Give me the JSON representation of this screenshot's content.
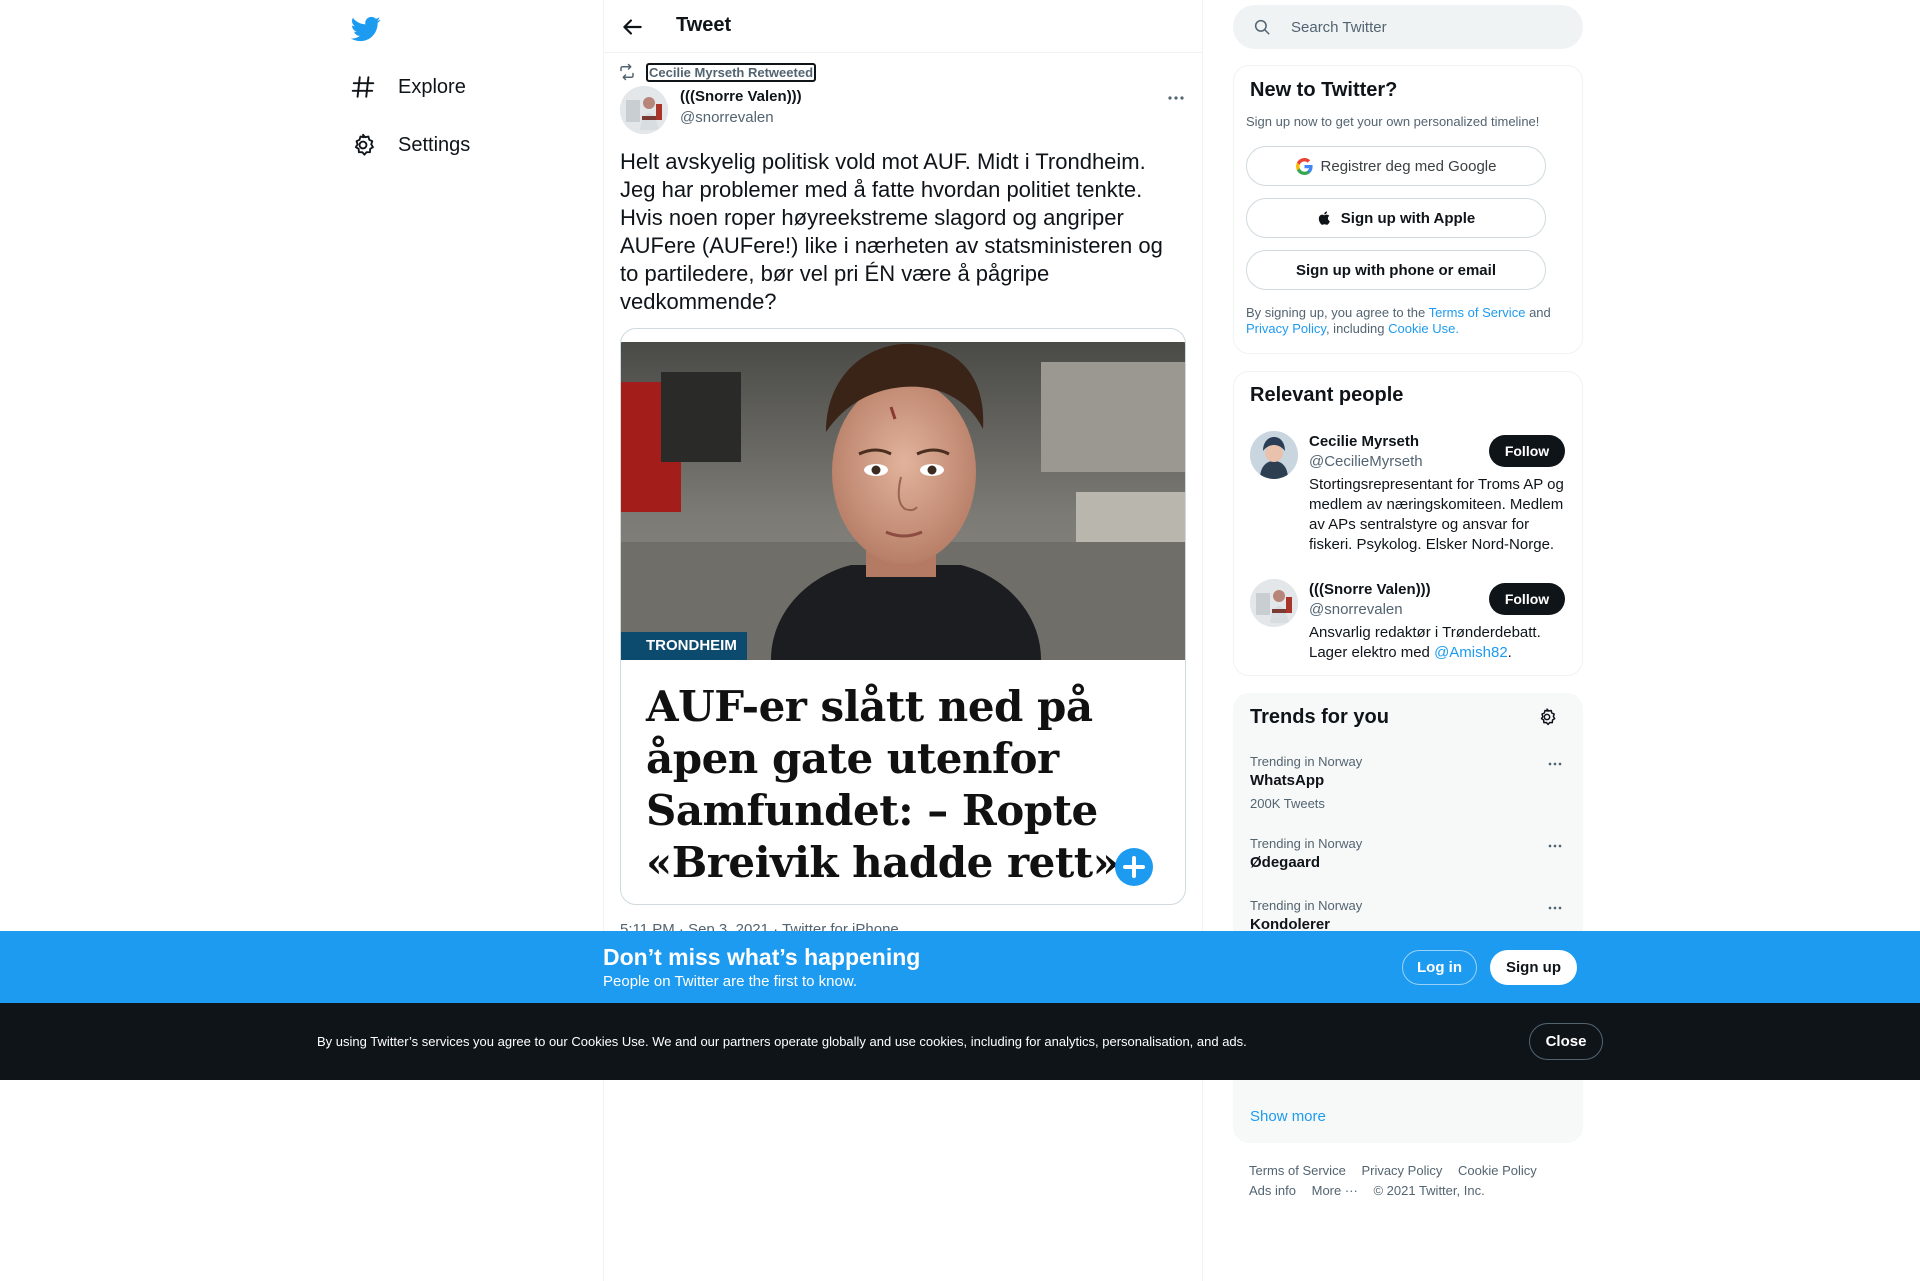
{
  "nav": {
    "logo": "twitter-bird-icon",
    "items": [
      {
        "label": "Explore",
        "icon": "hashtag-icon"
      },
      {
        "label": "Settings",
        "icon": "gear-icon"
      }
    ]
  },
  "header": {
    "title": "Tweet"
  },
  "tweet": {
    "retweeted_by": "Cecilie Myrseth Retweeted",
    "author_name": "(((Snorre Valen)))",
    "author_handle": "@snorrevalen",
    "text": "Helt avskyelig politisk vold mot AUF. Midt i Trondheim. Jeg har problemer med å fatte hvordan politiet tenkte. Hvis noen roper høyreekstreme slagord og angriper AUFere (AUFere!) like i nærheten av statsministeren og to partiledere, bør vel pri ÉN være å pågripe vedkommende?",
    "card": {
      "tag": "TRONDHEIM",
      "headline": "AUF-er slått ned på åpen gate utenfor Samfundet: – Ropte «Breivik hadde rett»"
    },
    "meta": "5:11 PM · Sep 3, 2021 · Twitter for iPhone"
  },
  "search": {
    "placeholder": "Search Twitter"
  },
  "signup": {
    "title": "New to Twitter?",
    "subtitle": "Sign up now to get your own personalized timeline!",
    "google": "Registrer deg med Google",
    "apple": "Sign up with Apple",
    "phone": "Sign up with phone or email",
    "legal_prefix": "By signing up, you agree to the",
    "terms": "Terms of Service",
    "and": "and",
    "privacy": "Privacy Policy",
    "including": ", including",
    "cookie": "Cookie Use."
  },
  "people": {
    "title": "Relevant people",
    "list": [
      {
        "name": "Cecilie Myrseth",
        "handle": "@CecilieMyrseth",
        "bio": "Stortingsrepresentant for Troms AP og medlem av næringskomiteen. Medlem av APs sentralstyre og ansvar for fiskeri. Psykolog. Elsker Nord-Norge.",
        "follow": "Follow"
      },
      {
        "name": "(((Snorre Valen)))",
        "handle": "@snorrevalen",
        "bio_prefix": "Ansvarlig redaktør i Trønderdebatt. Lager elektro med",
        "bio_link": "@Amish82",
        "bio_suffix": ".",
        "follow": "Follow"
      }
    ]
  },
  "trends": {
    "title": "Trends for you",
    "items": [
      {
        "meta": "Trending in Norway",
        "name": "WhatsApp",
        "count": "200K Tweets"
      },
      {
        "meta": "Trending in Norway",
        "name": "Ødegaard",
        "count": ""
      },
      {
        "meta": "Trending in Norway",
        "name": "Kondolerer",
        "count": ""
      }
    ],
    "show_more": "Show more"
  },
  "footer": {
    "terms": "Terms of Service",
    "privacy": "Privacy Policy",
    "cookie": "Cookie Policy",
    "ads": "Ads info",
    "more": "More ···",
    "copyright": "© 2021 Twitter, Inc."
  },
  "bottom_bar": {
    "title": "Don’t miss what’s happening",
    "subtitle": "People on Twitter are the first to know.",
    "login": "Log in",
    "signup": "Sign up"
  },
  "cookie_bar": {
    "text": "By using Twitter’s services you agree to our Cookies Use. We and our partners operate globally and use cookies, including for analytics, personalisation, and ads.",
    "close": "Close"
  },
  "colors": {
    "accent": "#1d9bf0",
    "text": "#0f1419",
    "secondary": "#536471",
    "cookie_bg": "#0f1419"
  }
}
